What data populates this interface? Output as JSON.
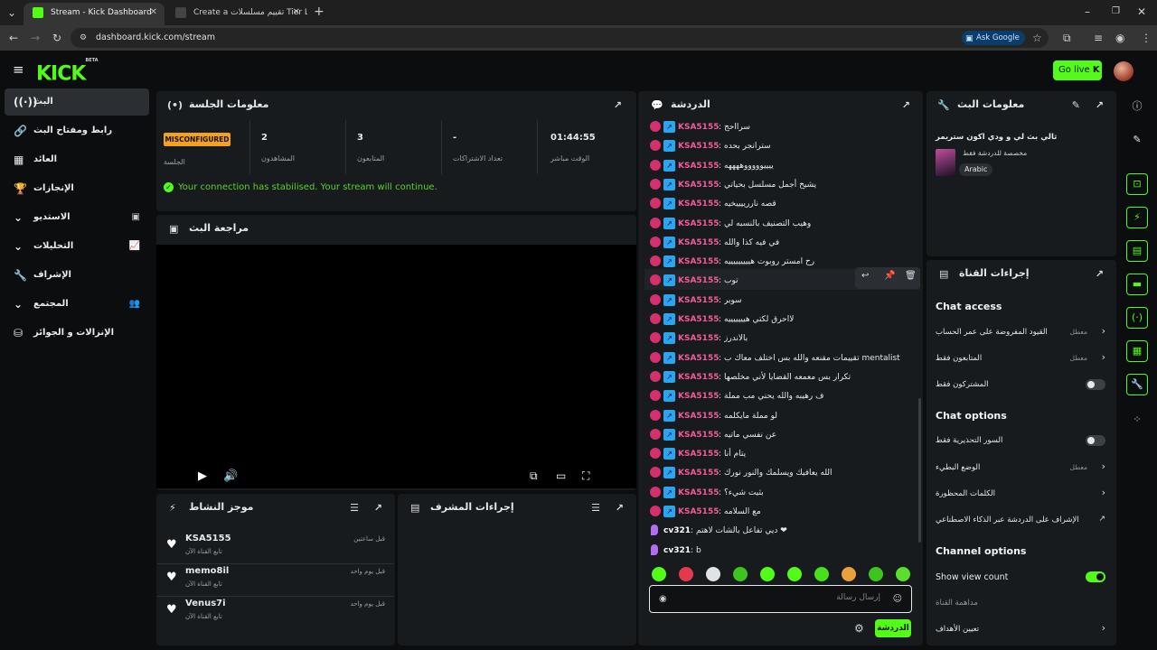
{
  "browser": {
    "tabs": [
      {
        "title": "Stream - Kick Dashboard",
        "active": true
      },
      {
        "title": "Create a تقييم مسلسلات Tier Lis",
        "active": false
      }
    ],
    "url": "dashboard.kick.com/stream",
    "ask_google": "Ask Google"
  },
  "header": {
    "logo": "KICK",
    "logo_sup": "BETA",
    "go_live": "Go live"
  },
  "sidebar": {
    "items": [
      {
        "label": "البث",
        "icon": "broadcast-icon",
        "active": true
      },
      {
        "label": "رابط ومفتاح البث",
        "icon": "link-icon"
      },
      {
        "label": "العائد",
        "icon": "chart-icon"
      },
      {
        "label": "الإنجازات",
        "icon": "trophy-icon"
      },
      {
        "label": "الاستديو",
        "icon": "studio-icon",
        "expandable": true
      },
      {
        "label": "التحليلات",
        "icon": "analytics-icon",
        "expandable": true
      },
      {
        "label": "الإشراف",
        "icon": "wrench-icon"
      },
      {
        "label": "المجتمع",
        "icon": "community-icon",
        "expandable": true
      },
      {
        "label": "الإنزالات و الجوائز",
        "icon": "drops-icon"
      }
    ]
  },
  "session": {
    "title": "معلومات الجلسة",
    "badge": "MISCONFIGURED",
    "badge_label": "الجلسة",
    "stats": [
      {
        "value": "2",
        "label": "المشاهدون"
      },
      {
        "value": "3",
        "label": "المتابعون"
      },
      {
        "value": "-",
        "label": "تعداد الاشتراكات"
      },
      {
        "value": "01:44:55",
        "label": "الوقت مباشر"
      }
    ],
    "notice": "Your connection has stabilised. Your stream will continue."
  },
  "preview": {
    "title": "مراجعة البث"
  },
  "activity": {
    "title": "موجز النشاط",
    "items": [
      {
        "user": "KSA5155",
        "action": "تابع القناة الآن",
        "time": "قبل ساعتين"
      },
      {
        "user": "memo8il",
        "action": "تابع القناة الآن",
        "time": "قبل يوم واحد"
      },
      {
        "user": "Venus7i",
        "action": "تابع القناة الآن",
        "time": "قبل يوم واحد"
      }
    ]
  },
  "mod": {
    "title": "إجراءات المشرف"
  },
  "chat": {
    "title": "الدردشة",
    "messages": [
      {
        "user": "KSA5155",
        "text": "سرااحج"
      },
      {
        "user": "KSA5155",
        "text": "سترانجر بحده"
      },
      {
        "user": "KSA5155",
        "text": "ييييوووووههههه"
      },
      {
        "user": "KSA5155",
        "text": "يشيخ أجمل مسلسل بحياتي"
      },
      {
        "user": "KSA5155",
        "text": "قصه ناررييييخيه"
      },
      {
        "user": "KSA5155",
        "text": "وهيب التصنيف بالنسبه لي"
      },
      {
        "user": "KSA5155",
        "text": "في فيه كذا والله"
      },
      {
        "user": "KSA5155",
        "text": "رح امستر روبوت هيييييييييه"
      },
      {
        "user": "KSA5155",
        "text": "توب"
      },
      {
        "user": "KSA5155",
        "text": "سوبر"
      },
      {
        "user": "KSA5155",
        "text": "لااحرق لكتي هيييييييه"
      },
      {
        "user": "KSA5155",
        "text": "بالاندرز"
      },
      {
        "user": "KSA5155",
        "text": "تقييمات مقنعه والله بس اختلف معاك ب mentalist"
      },
      {
        "user": "KSA5155",
        "text": "تكرار بس معمعه القضايا لأني مخلصها"
      },
      {
        "user": "KSA5155",
        "text": "ف رهيبه والله يحني مب مملة"
      },
      {
        "user": "KSA5155",
        "text": "لو مملة مايكلمه"
      },
      {
        "user": "KSA5155",
        "text": "عن نفسي ماتيه"
      },
      {
        "user": "KSA5155",
        "text": "يتام أنا"
      },
      {
        "user": "KSA5155",
        "text": "الله يعافيك ويسلمك والنور نورك"
      },
      {
        "user": "KSA5155",
        "text": "بثيت شيء؟"
      },
      {
        "user": "KSA5155",
        "text": "مع السلامه"
      },
      {
        "user": "cv321",
        "text": "ديي تفاعل بالشات لاهتم ❤",
        "alt": true
      },
      {
        "user": "cv321",
        "text": "b",
        "alt": true
      }
    ],
    "input_placeholder": "إرسال رسالة",
    "send_label": "الدردشة"
  },
  "stream_info": {
    "title": "معلومات البث",
    "stream_title": "ثالي بث لي و ودي اكون ستريمر",
    "category": "مخصصة للدردشة فقط",
    "language": "Arabic"
  },
  "channel_actions": {
    "title": "إجراءات القناة",
    "chat_access": {
      "title": "Chat access",
      "rows": [
        {
          "label": "القيود المفروضة على عمر الحساب",
          "value": "معطل",
          "type": "chevron"
        },
        {
          "label": "المتابعون فقط",
          "value": "معطل",
          "type": "chevron"
        },
        {
          "label": "المشتركون فقط",
          "value": "",
          "type": "toggle",
          "on": false
        }
      ]
    },
    "chat_options": {
      "title": "Chat options",
      "rows": [
        {
          "label": "السور التحذيرية فقط",
          "value": "",
          "type": "toggle",
          "on": false
        },
        {
          "label": "الوضع البطيء",
          "value": "معطل",
          "type": "chevron"
        },
        {
          "label": "الكلمات المحظورة",
          "value": "",
          "type": "chevron"
        },
        {
          "label": "الإشراف على الدردشة عبر الذكاء الاصطناعي",
          "value": "",
          "type": "external"
        }
      ]
    },
    "channel_options": {
      "title": "Channel options",
      "rows": [
        {
          "label": "Show view count",
          "value": "",
          "type": "toggle",
          "on": true
        },
        {
          "label": "مداهمة القناة",
          "value": "",
          "type": "none"
        },
        {
          "label": "تعيين الأهداف",
          "value": "",
          "type": "chevron"
        }
      ]
    }
  },
  "colors": {
    "accent": "#53fc18",
    "username": "#f4599a",
    "warning": "#f4a11c",
    "panel": "#181b1e"
  }
}
